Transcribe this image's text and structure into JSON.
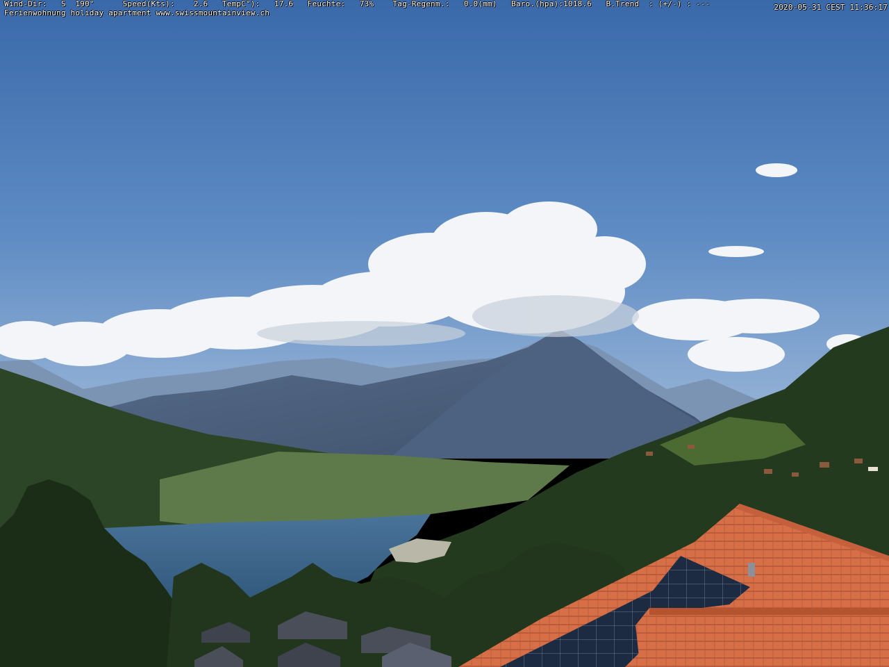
{
  "overlay": {
    "weather_line": "Wind-Dir:   S  190°      Speed(Kts):    2.6   TempC°):   17.6   Feuchte:   73%    Tag-Regenm.:   0.0(mm)   Baro.(hpa):1018.6   B.Trend  : (+/-) : ---",
    "site_line": "Ferienwohnung holiday apartment www.swissmountainview.ch",
    "timestamp": "2020-05-31 CEST 11:36:17"
  },
  "colors": {
    "sky_top": "#3f6fae",
    "sky_horizon": "#86a9d4",
    "cloud": "#f4f6f8",
    "mountain_far": "#6f89a8",
    "mountain_peak": "#4b5f78",
    "lake": "#3f678e",
    "forest": "#23381f",
    "roof_tile": "#d9734d",
    "solar_panel": "#1f2e45"
  }
}
